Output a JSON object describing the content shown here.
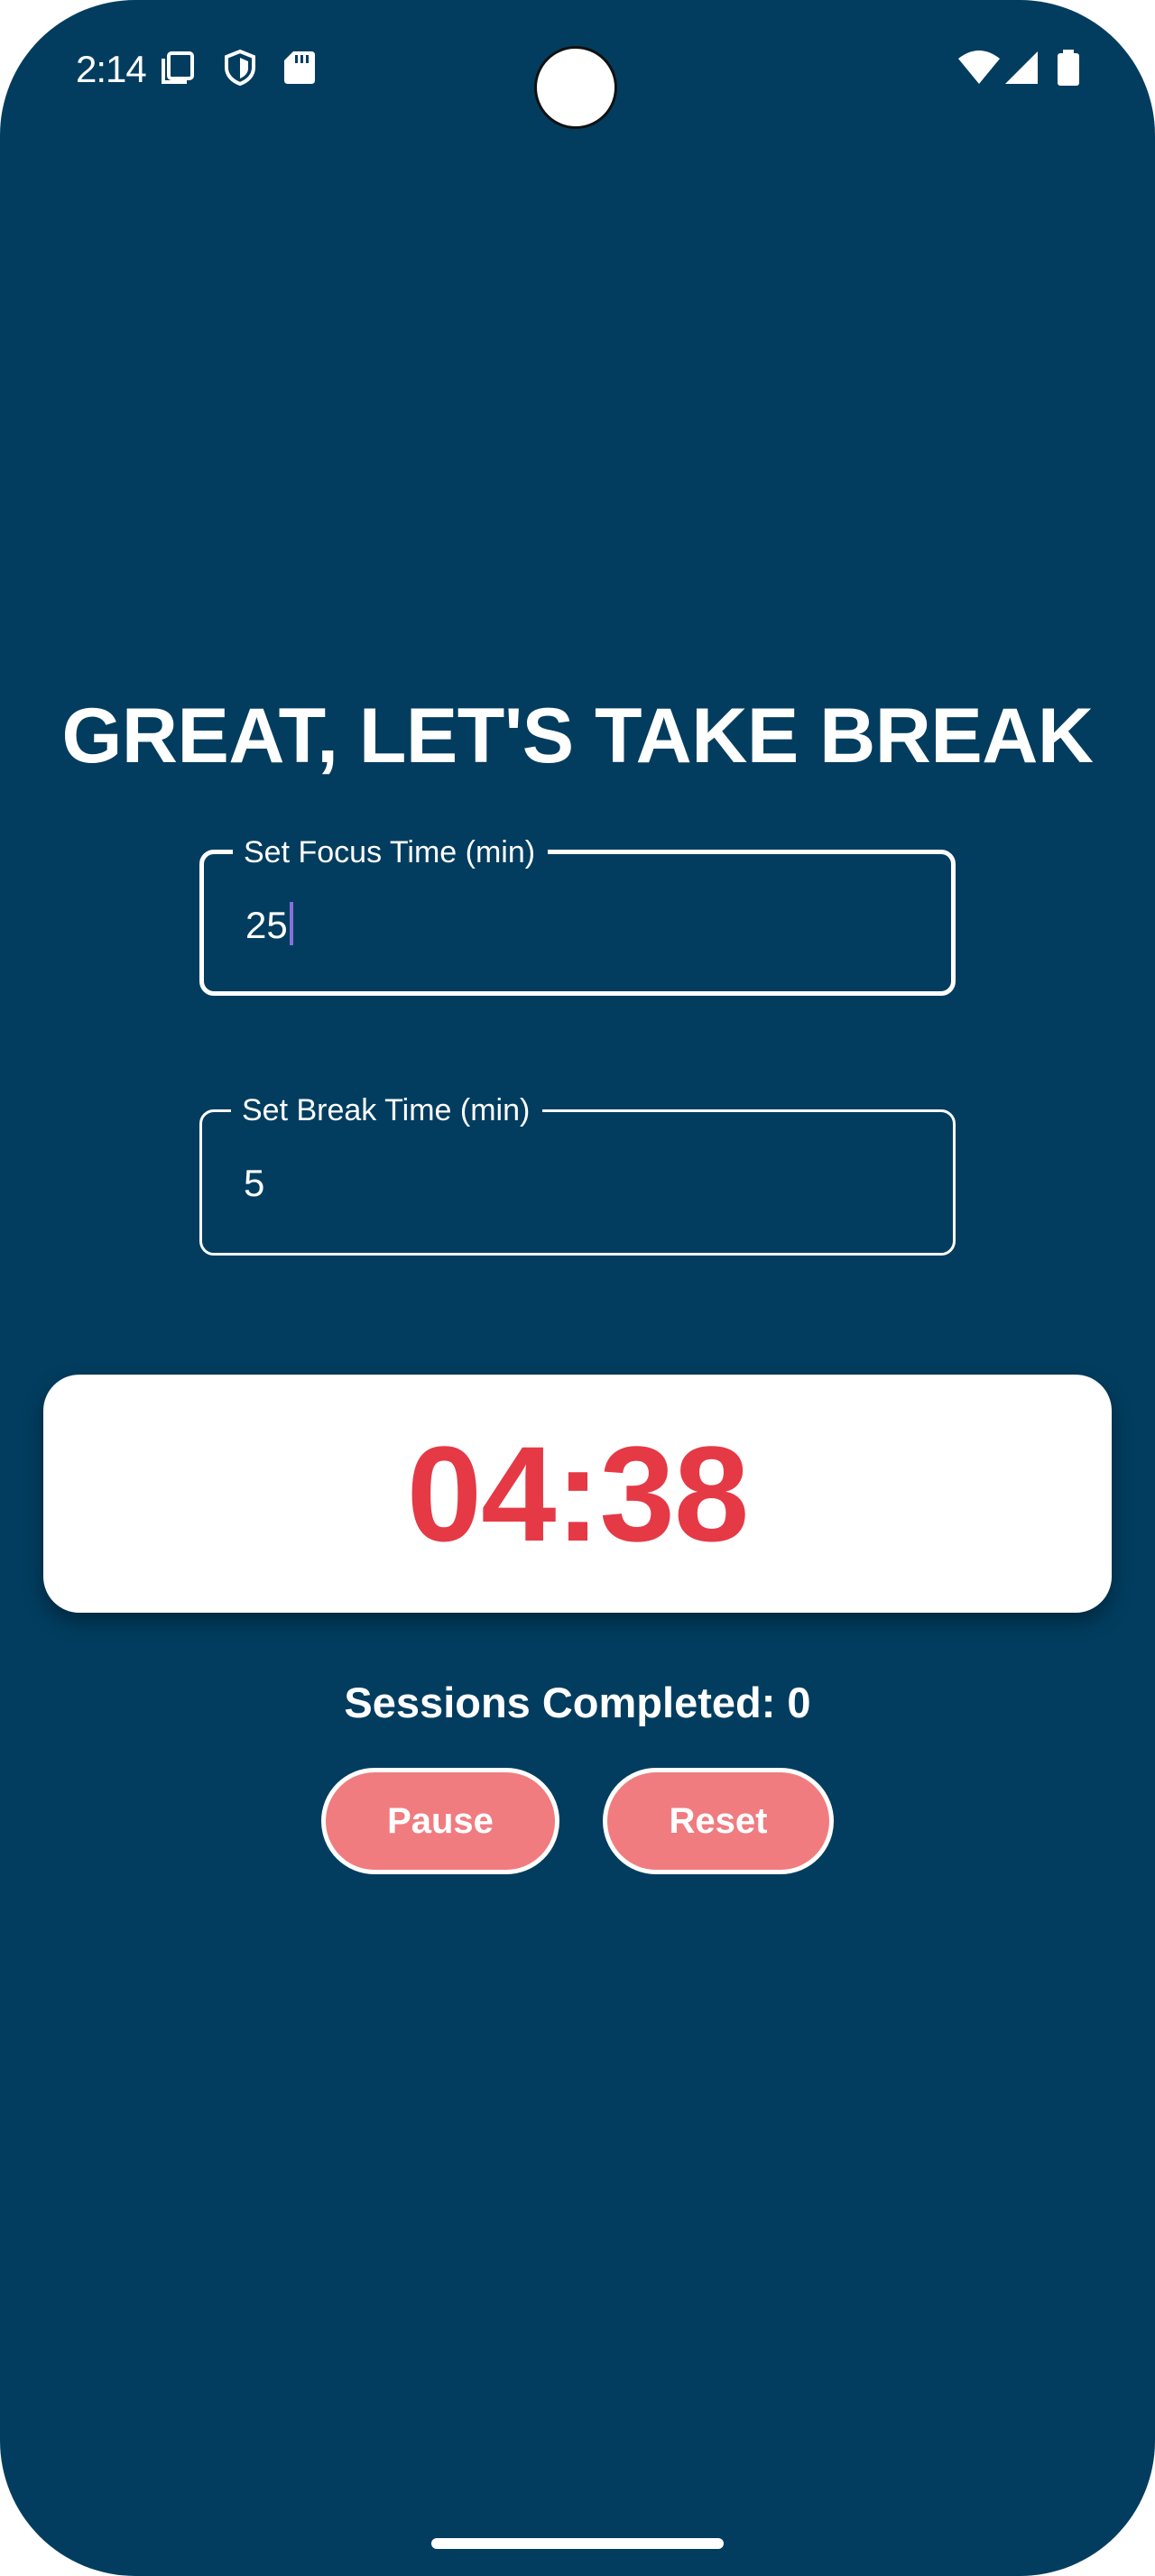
{
  "status_bar": {
    "time": "2:14",
    "left_icons": [
      "screenshot-icon",
      "shield-icon",
      "sd-card-icon"
    ],
    "right_icons": [
      "wifi-icon",
      "cell-signal-icon",
      "battery-icon"
    ]
  },
  "colors": {
    "background": "#023d5f",
    "card": "#ffffff",
    "timer": "#e53946",
    "button": "#f07c80",
    "caret": "#8a6fd6"
  },
  "main": {
    "title": "GREAT, LET'S TAKE BREAK",
    "focus_field": {
      "label": "Set Focus Time (min)",
      "value": "25"
    },
    "break_field": {
      "label": "Set Break Time (min)",
      "value": "5"
    },
    "timer": "04:38",
    "sessions": "Sessions Completed: 0",
    "buttons": {
      "pause": "Pause",
      "reset": "Reset"
    }
  }
}
